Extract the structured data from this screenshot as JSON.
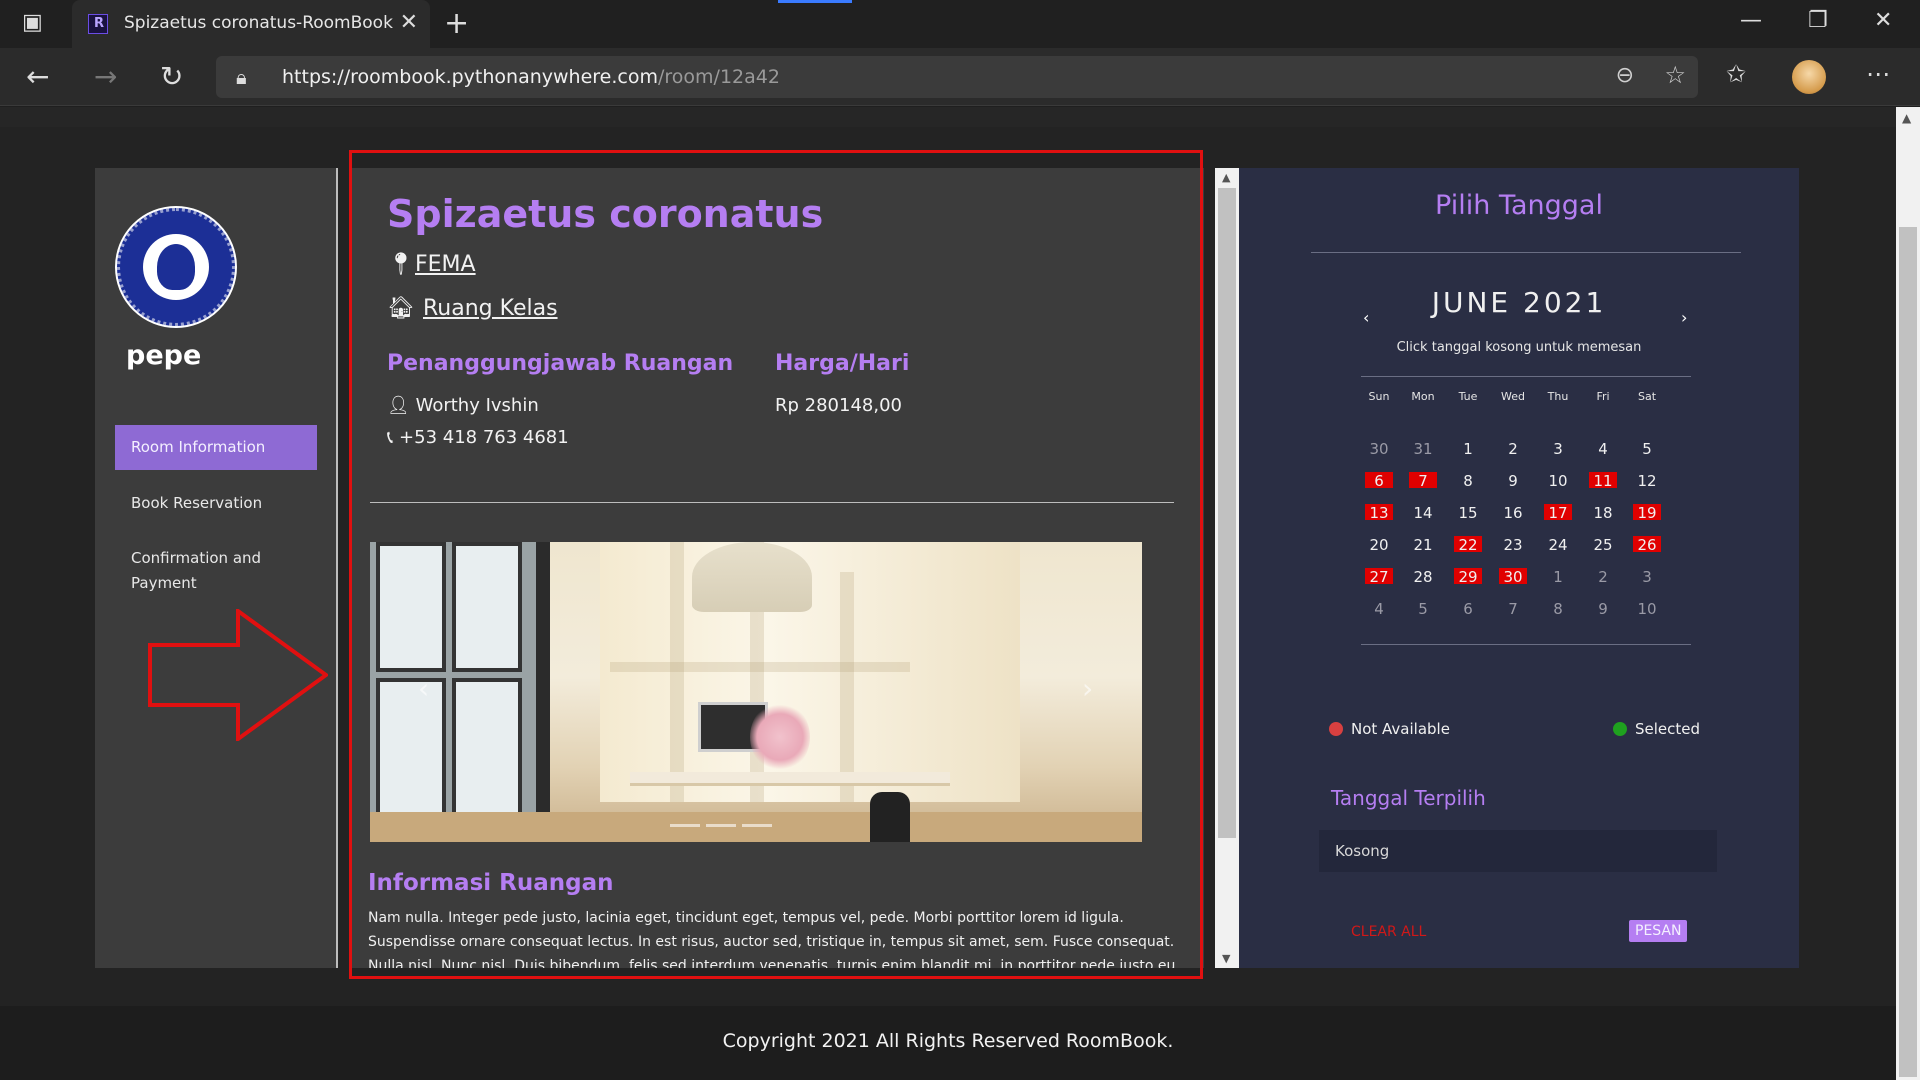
{
  "browser": {
    "tab_title": "Spizaetus coronatus-RoomBook",
    "url_host": "https://roombook.pythonanywhere.com",
    "url_path": "/room/12a42"
  },
  "sidebar": {
    "user_name": "pepe",
    "items": [
      {
        "label": "Room Information",
        "active": true
      },
      {
        "label": "Book Reservation",
        "active": false
      },
      {
        "label": "Confirmation and Payment",
        "active": false
      }
    ]
  },
  "room": {
    "title": "Spizaetus coronatus",
    "location": "FEMA",
    "category": "Ruang Kelas",
    "pic_heading": "Penanggungjawab Ruangan",
    "pic_name": "Worthy Ivshin",
    "pic_phone": "+53 418 763 4681",
    "price_heading": "Harga/Hari",
    "price": "Rp 280148,00",
    "info_heading": "Informasi Ruangan",
    "info_text": "Nam nulla. Integer pede justo, lacinia eget, tincidunt eget, tempus vel, pede. Morbi porttitor lorem id ligula. Suspendisse ornare consequat lectus. In est risus, auctor sed, tristique in, tempus sit amet, sem. Fusce consequat. Nulla nisl. Nunc nisl. Duis bibendum, felis sed interdum venenatis, turpis enim blandit mi, in porttitor pede justo eu massa."
  },
  "calendar": {
    "title": "Pilih Tanggal",
    "month": "JUNE 2021",
    "hint": "Click tanggal kosong untuk memesan",
    "weekdays": [
      "Sun",
      "Mon",
      "Tue",
      "Wed",
      "Thu",
      "Fri",
      "Sat"
    ],
    "weeks": [
      [
        {
          "d": "30",
          "s": "muted"
        },
        {
          "d": "31",
          "s": "muted"
        },
        {
          "d": "1",
          "s": ""
        },
        {
          "d": "2",
          "s": ""
        },
        {
          "d": "3",
          "s": ""
        },
        {
          "d": "4",
          "s": ""
        },
        {
          "d": "5",
          "s": ""
        }
      ],
      [
        {
          "d": "6",
          "s": "na"
        },
        {
          "d": "7",
          "s": "na"
        },
        {
          "d": "8",
          "s": ""
        },
        {
          "d": "9",
          "s": ""
        },
        {
          "d": "10",
          "s": ""
        },
        {
          "d": "11",
          "s": "na"
        },
        {
          "d": "12",
          "s": ""
        }
      ],
      [
        {
          "d": "13",
          "s": "na"
        },
        {
          "d": "14",
          "s": ""
        },
        {
          "d": "15",
          "s": ""
        },
        {
          "d": "16",
          "s": ""
        },
        {
          "d": "17",
          "s": "na"
        },
        {
          "d": "18",
          "s": ""
        },
        {
          "d": "19",
          "s": "na"
        }
      ],
      [
        {
          "d": "20",
          "s": ""
        },
        {
          "d": "21",
          "s": ""
        },
        {
          "d": "22",
          "s": "na"
        },
        {
          "d": "23",
          "s": ""
        },
        {
          "d": "24",
          "s": ""
        },
        {
          "d": "25",
          "s": ""
        },
        {
          "d": "26",
          "s": "na"
        }
      ],
      [
        {
          "d": "27",
          "s": "na"
        },
        {
          "d": "28",
          "s": ""
        },
        {
          "d": "29",
          "s": "na"
        },
        {
          "d": "30",
          "s": "na"
        },
        {
          "d": "1",
          "s": "muted"
        },
        {
          "d": "2",
          "s": "muted"
        },
        {
          "d": "3",
          "s": "muted"
        }
      ],
      [
        {
          "d": "4",
          "s": "muted"
        },
        {
          "d": "5",
          "s": "muted"
        },
        {
          "d": "6",
          "s": "muted"
        },
        {
          "d": "7",
          "s": "muted"
        },
        {
          "d": "8",
          "s": "muted"
        },
        {
          "d": "9",
          "s": "muted"
        },
        {
          "d": "10",
          "s": "muted"
        }
      ]
    ],
    "legend_not_available": "Not Available",
    "legend_selected": "Selected",
    "selected_heading": "Tanggal Terpilih",
    "selected_value": "Kosong",
    "clear_label": "CLEAR ALL",
    "submit_label": "PESAN",
    "colors": {
      "not_available": "#e00000",
      "selected": "#1fa11f",
      "accent": "#b57ef2"
    }
  },
  "footer": {
    "copyright": "Copyright 2021 All Rights Reserved RoomBook."
  }
}
